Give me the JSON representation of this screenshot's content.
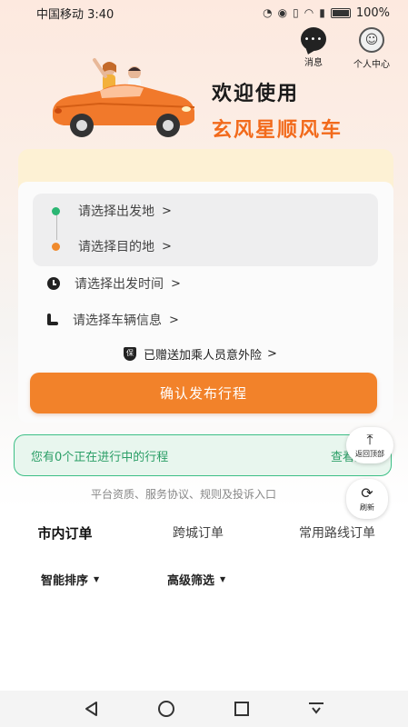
{
  "status_bar": {
    "carrier_time": "中国移动 3:40",
    "icons": [
      "speedometer-icon",
      "eye-icon",
      "vibrate-icon",
      "wifi-icon",
      "signal-icon",
      "battery-icon"
    ],
    "battery": "100%"
  },
  "header": {
    "messages_label": "消息",
    "profile_label": "个人中心",
    "welcome_line1": "欢迎使用",
    "welcome_line2": "玄风星顺风车"
  },
  "booking": {
    "origin_placeholder": "请选择出发地",
    "destination_placeholder": "请选择目的地",
    "time_placeholder": "请选择出发时间",
    "vehicle_placeholder": "请选择车辆信息",
    "chevron": ">",
    "insurance_badge": "保",
    "insurance_text": "已赠送加乘人员意外险",
    "confirm_button": "确认发布行程"
  },
  "trips": {
    "ongoing_text": "您有0个正在进行中的行程",
    "view_all_link": "查看全部"
  },
  "float_buttons": {
    "back_to_top": "返回顶部",
    "refresh": "刷新"
  },
  "footer": {
    "links_text": "平台资质、服务协议、规则及投诉入口"
  },
  "tabs": [
    {
      "label": "市内订单",
      "active": true
    },
    {
      "label": "跨城订单",
      "active": false
    },
    {
      "label": "常用路线订单",
      "active": false
    }
  ],
  "filters": {
    "sort_label": "智能排序",
    "advanced_label": "高级筛选",
    "caret": "▼"
  },
  "colors": {
    "accent": "#f2822a",
    "brand_text": "#f26a1b",
    "success": "#2bb673"
  }
}
